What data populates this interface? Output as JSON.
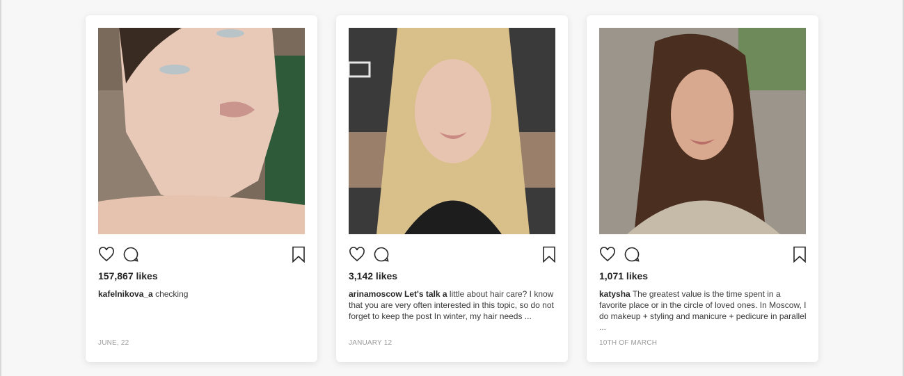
{
  "posts": [
    {
      "likes": "157,867 likes",
      "username": "kafelnikova_a",
      "caption": "checking",
      "date": "JUNE, 22"
    },
    {
      "likes": "3,142 likes",
      "username": "arinamoscow Let's talk a",
      "caption": "little about hair care? I know that you are very often interested in this topic, so do not forget to keep the post In winter, my hair needs ...",
      "date": "JANUARY 12"
    },
    {
      "likes": "1,071 likes",
      "username": "katysha",
      "caption": "The greatest value is the time spent in a favorite place or in the circle of loved ones. In Moscow, I do makeup + styling and manicure + pedicure in parallel ...",
      "date": "10TH OF MARCH"
    }
  ],
  "icons": {
    "like": "heart-icon",
    "comment": "comment-bubble-icon",
    "save": "bookmark-icon"
  },
  "colors": {
    "background": "#f7f7f7",
    "card": "#ffffff",
    "text": "#262626",
    "muted": "#9a9a9a"
  }
}
